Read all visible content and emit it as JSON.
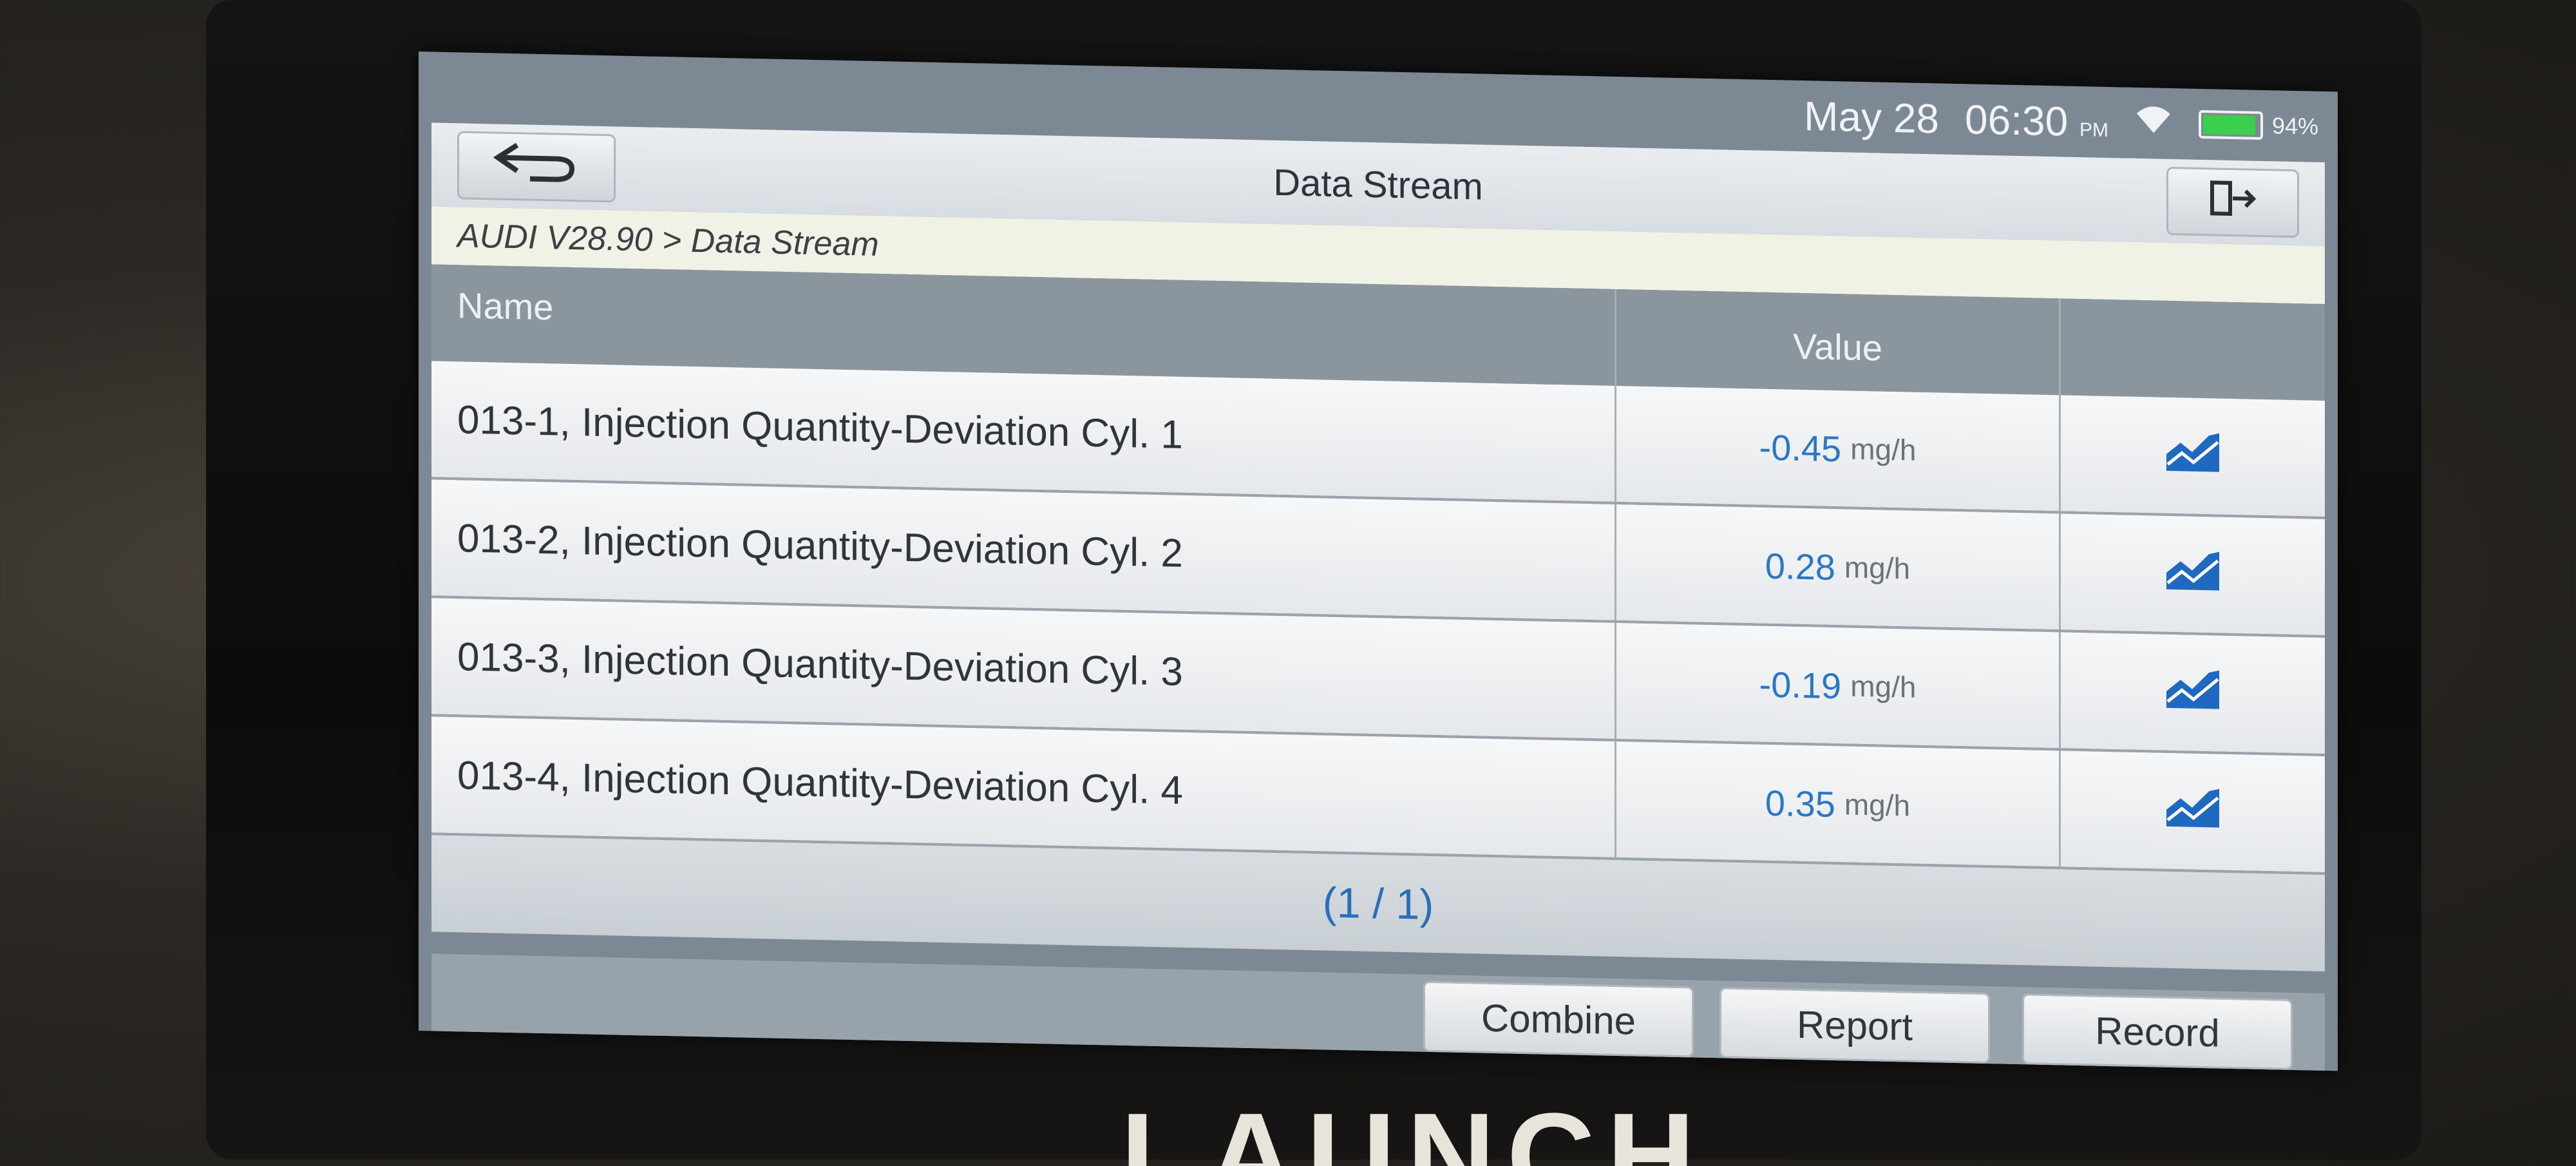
{
  "status": {
    "date": "May 28",
    "time": "06:30",
    "ampm": "PM",
    "battery": "94%",
    "wifi_icon": "wifi-icon"
  },
  "header": {
    "title": "Data Stream",
    "back_icon": "back-arrow-icon",
    "exit_icon": "exit-icon"
  },
  "breadcrumb": "AUDI V28.90 > Data Stream",
  "table": {
    "columns": {
      "name": "Name",
      "value": "Value"
    },
    "rows": [
      {
        "name": "013-1, Injection Quantity-Deviation Cyl. 1",
        "value": "-0.45",
        "unit": "mg/h"
      },
      {
        "name": "013-2, Injection Quantity-Deviation Cyl. 2",
        "value": "0.28",
        "unit": "mg/h"
      },
      {
        "name": "013-3, Injection Quantity-Deviation Cyl. 3",
        "value": "-0.19",
        "unit": "mg/h"
      },
      {
        "name": "013-4, Injection Quantity-Deviation Cyl. 4",
        "value": "0.35",
        "unit": "mg/h"
      }
    ]
  },
  "pager": "(1 / 1)",
  "buttons": {
    "combine": "Combine",
    "report": "Report",
    "record": "Record"
  },
  "brand": "LAUNCH",
  "colors": {
    "value_blue": "#2a78c4",
    "graph_icon_blue": "#1f6ac0",
    "battery_green": "#3ccf4e"
  }
}
